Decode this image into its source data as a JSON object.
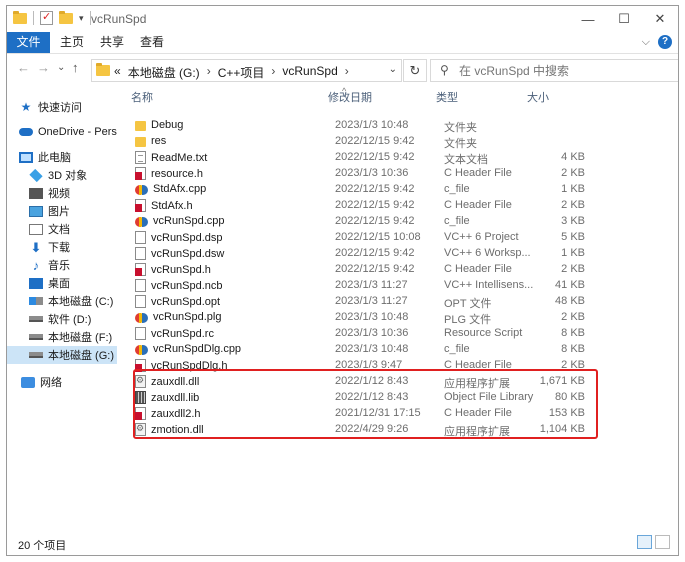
{
  "window": {
    "title": "vcRunSpd",
    "controls": {
      "minimize": "—",
      "maximize": "☐",
      "close": "✕"
    }
  },
  "ribbon": {
    "tabs": [
      "文件",
      "主页",
      "共享",
      "查看"
    ],
    "collapse_glyph": "⌵",
    "help_glyph": "?"
  },
  "nav": {
    "back_glyph": "←",
    "forward_glyph": "→",
    "recent_glyph": "⌄",
    "up_glyph": "↑",
    "path_prefix": "«",
    "path": [
      "本地磁盘 (G:)",
      "C++项目",
      "vcRunSpd"
    ],
    "path_sep": "›",
    "dropdown_glyph": "⌄",
    "refresh_glyph": "↻",
    "search_glyph": "⚲",
    "search_placeholder": "在 vcRunSpd 中搜索"
  },
  "sidebar": {
    "items": [
      {
        "label": "快速访问",
        "icon": "star-icon"
      },
      {
        "label": "OneDrive - Perso",
        "icon": "cloud-icon"
      },
      {
        "label": "此电脑",
        "icon": "pc-icon"
      },
      {
        "label": "3D 对象",
        "icon": "cube-icon"
      },
      {
        "label": "视频",
        "icon": "video-icon"
      },
      {
        "label": "图片",
        "icon": "picture-icon"
      },
      {
        "label": "文档",
        "icon": "document-icon"
      },
      {
        "label": "下载",
        "icon": "download-icon"
      },
      {
        "label": "音乐",
        "icon": "music-icon"
      },
      {
        "label": "桌面",
        "icon": "desktop-icon"
      },
      {
        "label": "本地磁盘 (C:)",
        "icon": "drive-icon"
      },
      {
        "label": "软件 (D:)",
        "icon": "drive-icon"
      },
      {
        "label": "本地磁盘 (F:)",
        "icon": "drive-icon"
      },
      {
        "label": "本地磁盘 (G:)",
        "icon": "drive-icon",
        "selected": true
      },
      {
        "label": "网络",
        "icon": "network-icon"
      }
    ],
    "star_glyph": "★",
    "download_glyph": "⬇",
    "music_glyph": "♪"
  },
  "columns": {
    "name": "名称",
    "date": "修改日期",
    "type": "类型",
    "size": "大小",
    "sort_glyph": "^"
  },
  "files": [
    {
      "name": "Debug",
      "date": "2023/1/3 10:48",
      "type": "文件夹",
      "size": "",
      "icon": "folder"
    },
    {
      "name": "res",
      "date": "2022/12/15 9:42",
      "type": "文件夹",
      "size": "",
      "icon": "folder"
    },
    {
      "name": "ReadMe.txt",
      "date": "2022/12/15 9:42",
      "type": "文本文档",
      "size": "4 KB",
      "icon": "txt"
    },
    {
      "name": "resource.h",
      "date": "2023/1/3 10:36",
      "type": "C Header File",
      "size": "2 KB",
      "icon": "h"
    },
    {
      "name": "StdAfx.cpp",
      "date": "2022/12/15 9:42",
      "type": "c_file",
      "size": "1 KB",
      "icon": "cpp"
    },
    {
      "name": "StdAfx.h",
      "date": "2022/12/15 9:42",
      "type": "C Header File",
      "size": "2 KB",
      "icon": "h"
    },
    {
      "name": "vcRunSpd.cpp",
      "date": "2022/12/15 9:42",
      "type": "c_file",
      "size": "3 KB",
      "icon": "cpp"
    },
    {
      "name": "vcRunSpd.dsp",
      "date": "2022/12/15 10:08",
      "type": "VC++ 6 Project",
      "size": "5 KB",
      "icon": "blank"
    },
    {
      "name": "vcRunSpd.dsw",
      "date": "2022/12/15 9:42",
      "type": "VC++ 6 Worksp...",
      "size": "1 KB",
      "icon": "blank"
    },
    {
      "name": "vcRunSpd.h",
      "date": "2022/12/15 9:42",
      "type": "C Header File",
      "size": "2 KB",
      "icon": "h"
    },
    {
      "name": "vcRunSpd.ncb",
      "date": "2023/1/3 11:27",
      "type": "VC++ Intellisens...",
      "size": "41 KB",
      "icon": "blank"
    },
    {
      "name": "vcRunSpd.opt",
      "date": "2023/1/3 11:27",
      "type": "OPT 文件",
      "size": "48 KB",
      "icon": "blank"
    },
    {
      "name": "vcRunSpd.plg",
      "date": "2023/1/3 10:48",
      "type": "PLG 文件",
      "size": "2 KB",
      "icon": "cpp"
    },
    {
      "name": "vcRunSpd.rc",
      "date": "2023/1/3 10:36",
      "type": "Resource Script",
      "size": "8 KB",
      "icon": "blank"
    },
    {
      "name": "vcRunSpdDlg.cpp",
      "date": "2023/1/3 10:48",
      "type": "c_file",
      "size": "8 KB",
      "icon": "cpp"
    },
    {
      "name": "vcRunSpdDlg.h",
      "date": "2023/1/3 9:47",
      "type": "C Header File",
      "size": "2 KB",
      "icon": "h"
    },
    {
      "name": "zauxdll.dll",
      "date": "2022/1/12 8:43",
      "type": "应用程序扩展",
      "size": "1,671 KB",
      "icon": "dll"
    },
    {
      "name": "zauxdll.lib",
      "date": "2022/1/12 8:43",
      "type": "Object File Library",
      "size": "80 KB",
      "icon": "lib"
    },
    {
      "name": "zauxdll2.h",
      "date": "2021/12/31 17:15",
      "type": "C Header File",
      "size": "153 KB",
      "icon": "h"
    },
    {
      "name": "zmotion.dll",
      "date": "2022/4/29 9:26",
      "type": "应用程序扩展",
      "size": "1,104 KB",
      "icon": "dll"
    }
  ],
  "status": {
    "count": "20 个项目"
  },
  "colors": {
    "accent": "#1e6fc5",
    "selected": "#cce4f7",
    "highlight_border": "#e02020"
  }
}
